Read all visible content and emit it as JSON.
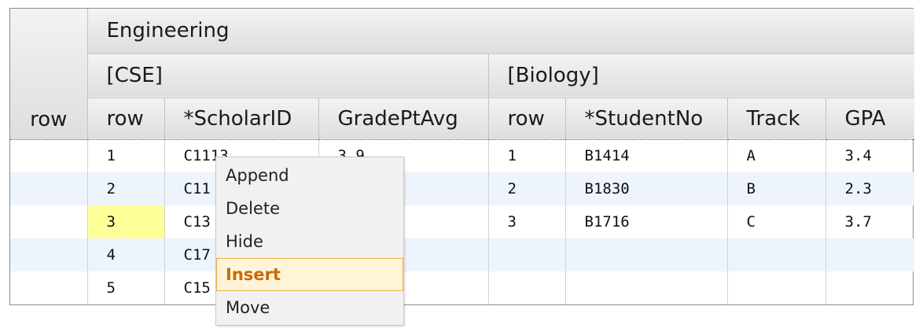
{
  "header": {
    "corner_label": "row",
    "group": "Engineering",
    "subgroups": [
      "[CSE]",
      "[Biology]"
    ],
    "columns": [
      "row",
      "*ScholarID",
      "GradePtAvg",
      "row",
      "*StudentNo",
      "Track",
      "GPA"
    ]
  },
  "rows": [
    [
      "",
      "1",
      "C1113",
      "3.9",
      "1",
      "B1414",
      "A",
      "3.4"
    ],
    [
      "",
      "2",
      "C11",
      "",
      "2",
      "B1830",
      "B",
      "2.3"
    ],
    [
      "",
      "3",
      "C13",
      "",
      "3",
      "B1716",
      "C",
      "3.7"
    ],
    [
      "",
      "4",
      "C17",
      "",
      "",
      "",
      "",
      ""
    ],
    [
      "",
      "5",
      "C15",
      "",
      "",
      "",
      "",
      ""
    ]
  ],
  "selected_cell": {
    "row": 3,
    "column": "row"
  },
  "context_menu": {
    "items": [
      "Append",
      "Delete",
      "Hide",
      "Insert",
      "Move"
    ],
    "active": "Insert"
  }
}
